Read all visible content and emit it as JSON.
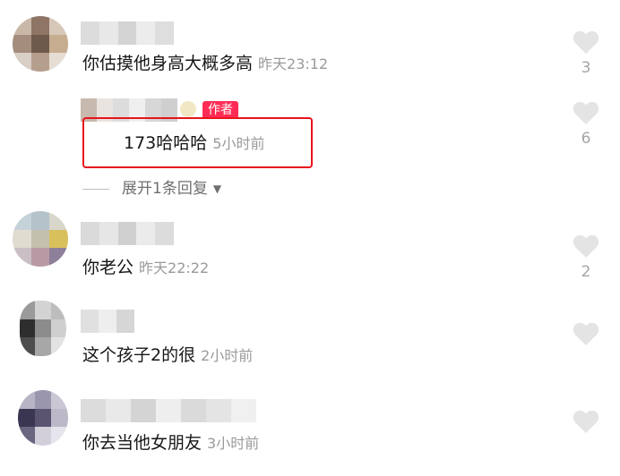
{
  "comments": [
    {
      "text": "你估摸他身高大概多高",
      "time": "昨天23:12",
      "likes": "3"
    },
    {
      "text": "173哈哈哈",
      "time": "5小时前",
      "likes": "6",
      "is_reply": true,
      "badge": "作者"
    },
    {
      "text": "你老公",
      "time": "昨天22:22",
      "likes": "2"
    },
    {
      "text": "这个孩子2的很",
      "time": "2小时前",
      "likes": ""
    },
    {
      "text": "你去当他女朋友",
      "time": "3小时前",
      "likes": ""
    }
  ],
  "expand_replies": {
    "label": "展开1条回复"
  },
  "colors": {
    "accent": "#fe2c55",
    "highlight_border": "#e8141b",
    "like_icon": "#e4e4e4"
  },
  "icons": {
    "like": "heart-icon",
    "expand": "caret-down-icon"
  }
}
